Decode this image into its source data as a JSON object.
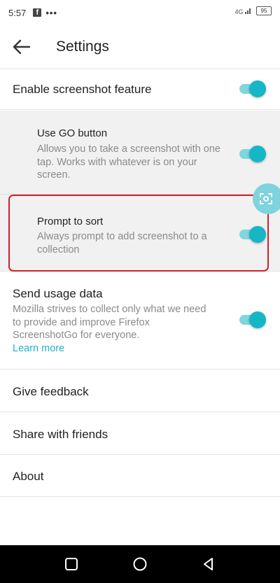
{
  "status_bar": {
    "time": "5:57",
    "facebook_glyph": "f",
    "more_dots": "•••",
    "signal_text": "4G",
    "battery_level": "95"
  },
  "app_bar": {
    "title": "Settings"
  },
  "settings": {
    "enable_screenshot": {
      "label": "Enable screenshot feature",
      "enabled": true
    },
    "use_go_button": {
      "title": "Use GO button",
      "description": "Allows you to take a screenshot with one tap. Works with whatever is on your screen.",
      "enabled": true
    },
    "prompt_to_sort": {
      "title": "Prompt to sort",
      "description": "Always prompt to add screenshot to a collection",
      "enabled": true
    },
    "send_usage_data": {
      "title": "Send usage data",
      "description": "Mozilla strives to collect only what we need to provide and improve Firefox ScreenshotGo for everyone.",
      "link": "Learn more",
      "enabled": true
    },
    "give_feedback": "Give feedback",
    "share_with_friends": "Share with friends",
    "about": "About"
  },
  "icons": {
    "back": "back-arrow-icon",
    "floating": "screenshot-capture-icon",
    "nav_recent": "recent-apps-icon",
    "nav_home": "home-icon",
    "nav_back": "nav-back-icon"
  },
  "colors": {
    "accent": "#15b6c6",
    "accent_light": "#7fd6df",
    "highlight": "#d0202a",
    "link": "#20b3c4"
  }
}
